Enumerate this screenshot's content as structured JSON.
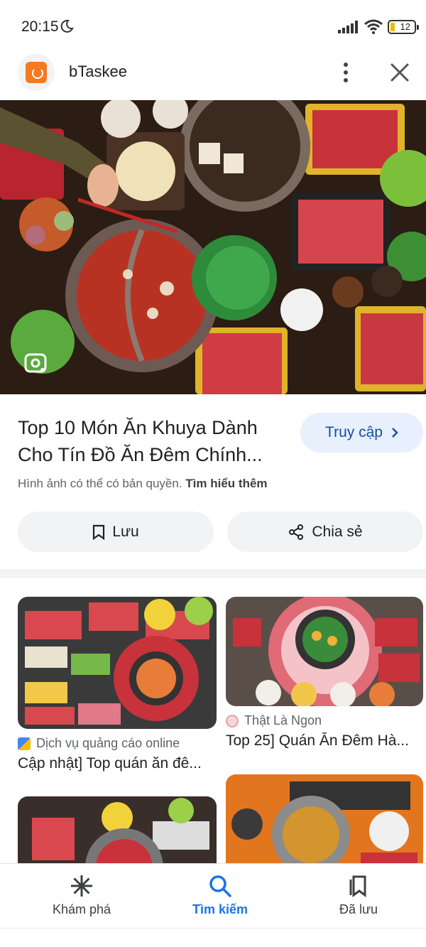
{
  "status_bar": {
    "time": "20:15",
    "battery": "12"
  },
  "header": {
    "site_name": "bTaskee",
    "logo_color": "#f47920",
    "icons": [
      "moon-icon",
      "signal-icon",
      "wifi-icon",
      "battery-icon",
      "more-vert-icon",
      "close-icon"
    ]
  },
  "hero": {
    "lens_icon": "google-lens-icon"
  },
  "detail": {
    "title_line1": "Top 10 Món Ăn Khuya Dành",
    "title_line2": "Cho Tín Đồ Ăn Đêm Chính...",
    "visit_label": "Truy cập",
    "copyright_text": "Hình ảnh có thể có bản quyền.",
    "learn_more": "Tìm hiểu thêm",
    "save_label": "Lưu",
    "share_label": "Chia sẻ"
  },
  "results": [
    {
      "source": "Dịch vụ quảng cáo online",
      "title": "Cập nhật] Top quán ăn đê..."
    },
    {
      "source": "Thật Là Ngon",
      "title": "Top 25] Quán Ăn Đêm Hà..."
    }
  ],
  "bottom_nav": {
    "items": [
      {
        "label": "Khám phá",
        "icon": "sparkle-icon"
      },
      {
        "label": "Tìm kiếm",
        "icon": "search-icon",
        "active": true
      },
      {
        "label": "Đã lưu",
        "icon": "bookmarks-icon"
      }
    ]
  },
  "colors": {
    "accent": "#1a73e8",
    "visit_bg": "#e8f0fe",
    "chip_bg": "#f1f3f4"
  }
}
